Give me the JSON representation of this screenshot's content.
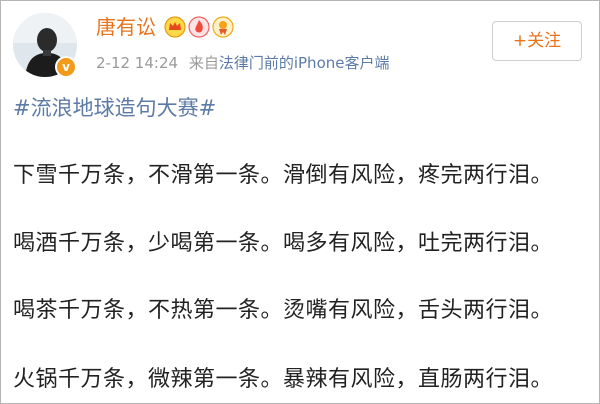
{
  "post": {
    "author": {
      "name": "唐有讼",
      "avatar_icon": "portrait-avatar",
      "verified_icon": "verified-v-icon",
      "verified_letter": "v",
      "badges": [
        "crown-badge-icon",
        "fire-badge-icon",
        "medal-badge-icon"
      ]
    },
    "meta": {
      "time": "2-12 14:24",
      "from": "来自",
      "source": "法律门前的iPhone客户端"
    },
    "follow_label": "+关注",
    "hashtag": "#流浪地球造句大赛#",
    "lines": [
      "下雪千万条，不滑第一条。滑倒有风险，疼完两行泪。",
      "喝酒千万条，少喝第一条。喝多有风险，吐完两行泪。",
      "喝茶千万条，不热第一条。烫嘴有风险，舌头两行泪。",
      "火锅千万条，微辣第一条。暴辣有风险，直肠两行泪。"
    ]
  },
  "colors": {
    "name": "#e8731a",
    "link": "#5d7ba7",
    "meta": "#9a9a9a",
    "text": "#222222",
    "verified": "#f39a1a"
  }
}
